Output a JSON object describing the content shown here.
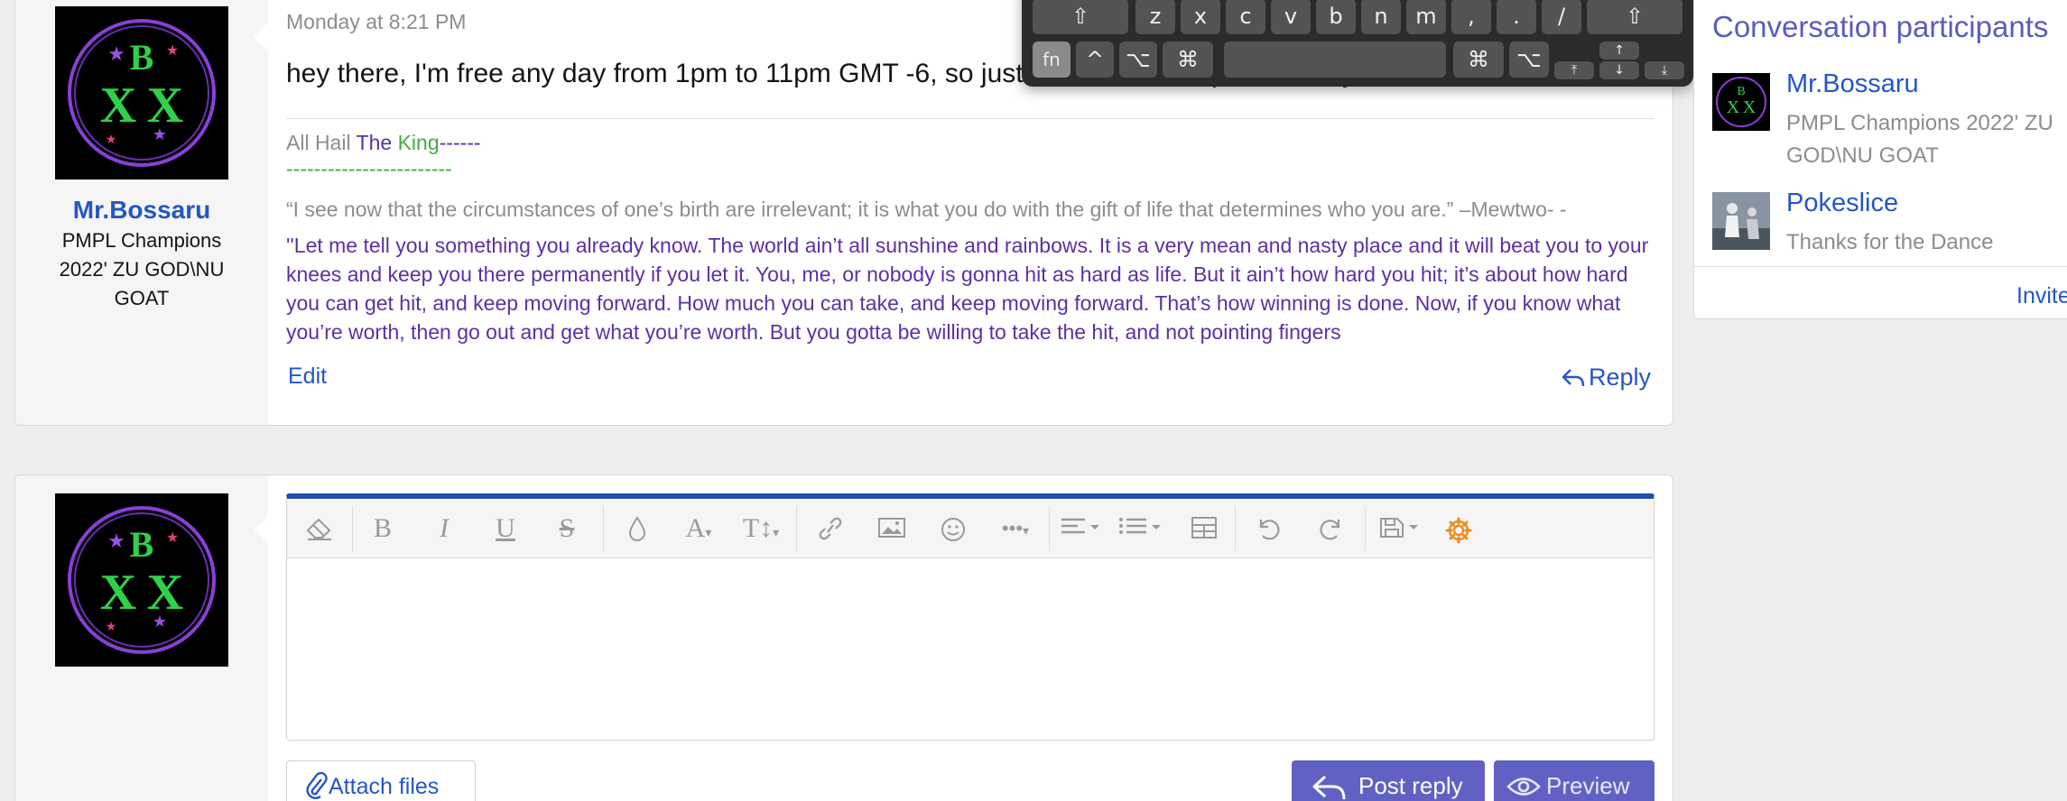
{
  "message": {
    "author": "Mr.Bossaru",
    "author_title": "PMPL Champions 2022' ZU GOD\\NU GOAT",
    "date": "Monday at 8:21 PM",
    "body": "hey there, I'm free any day from 1pm to 11pm GMT -6, so just let me know, u pick the day",
    "signature": {
      "hail_prefix": "All Hail ",
      "hail_the": "The ",
      "hail_king": "King",
      "hail_dashes": "------",
      "dash_line": "------------------------",
      "quote": "“I see now that the circumstances of one’s birth are irrelevant; it is what you do with the gift of life that determines who you are.” –Mewtwo- -",
      "long_quote": "''Let me tell you something you already know. The world ain’t all sunshine and rainbows. It is a very mean and nasty place and it will beat you to your knees and keep you there permanently if you let it. You, me, or nobody is gonna hit as hard as life. But it ain’t how hard you hit; it’s about how hard you can get hit, and keep moving forward. How much you can take, and keep moving forward. That’s how winning is done. Now, if you know what you’re worth, then go out and get what you’re worth. But you gotta be willing to take the hit, and not pointing fingers"
    },
    "edit_label": "Edit",
    "reply_label": "Reply"
  },
  "composer": {
    "attach_label": "Attach files",
    "post_label": "Post reply",
    "preview_label": "Preview",
    "toolbar_icons": [
      "eraser-icon",
      "bold-icon",
      "italic-icon",
      "underline-icon",
      "strikethrough-icon",
      "text-color-icon",
      "font-family-icon",
      "font-size-icon",
      "link-icon",
      "image-icon",
      "emoji-icon",
      "more-icon",
      "align-icon",
      "list-icon",
      "table-icon",
      "undo-icon",
      "redo-icon",
      "drafts-icon",
      "settings-icon"
    ]
  },
  "keyboard": {
    "row1": [
      "⇧",
      "z",
      "x",
      "c",
      "v",
      "b",
      "n",
      "m",
      ",",
      ".",
      "/",
      "⇧"
    ],
    "row2": [
      "fn",
      "^",
      "⌥",
      "⌘",
      "",
      "⌘",
      "⌥"
    ],
    "arrows": [
      "⤒",
      "↑",
      "↓",
      "⤓"
    ]
  },
  "sidebar": {
    "title": "Conversation participants",
    "participants": [
      {
        "name": "Mr.Bossaru",
        "title_line1": "PMPL Champions 2022' ZU",
        "title_line2": "GOD\\NU GOAT"
      },
      {
        "name": "Pokeslice",
        "title_line1": "Thanks for the Dance"
      }
    ],
    "invite_label": "Invite"
  },
  "colors": {
    "accent": "#2456c4",
    "button": "#6161c4",
    "editor_top": "#1f4fb0",
    "gear": "#f08c1e"
  }
}
